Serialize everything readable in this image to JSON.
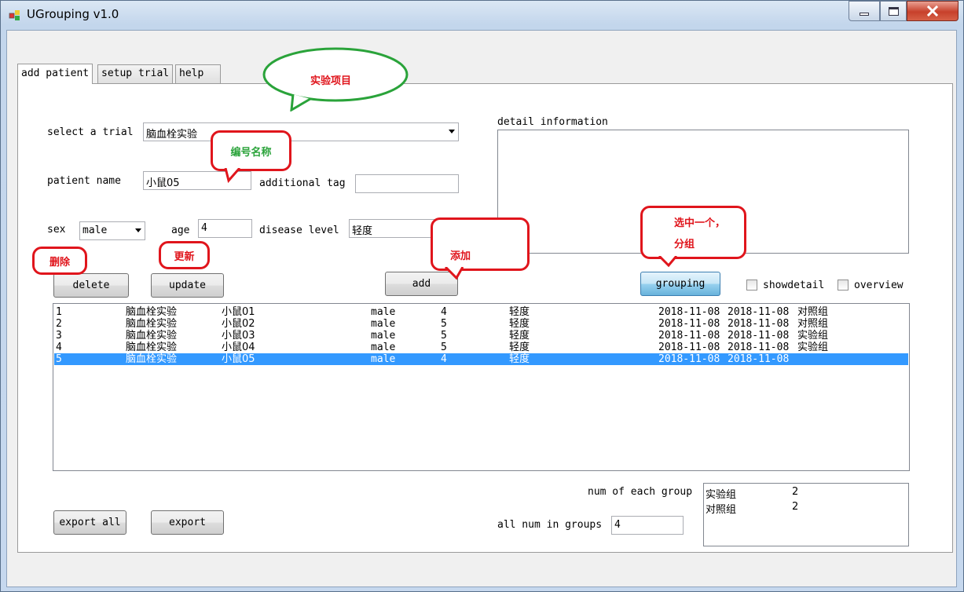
{
  "window": {
    "title": "UGrouping v1.0"
  },
  "tabs": [
    {
      "label": "add patient"
    },
    {
      "label": "setup trial"
    },
    {
      "label": "help"
    }
  ],
  "form": {
    "trial_label": "select a trial",
    "trial_value": "脑血栓实验",
    "patient_name_label": "patient name",
    "patient_name_value": "小鼠05",
    "additional_tag_label": "additional tag",
    "additional_tag_value": "",
    "sex_label": "sex",
    "sex_value": "male",
    "age_label": "age",
    "age_value": "4",
    "disease_level_label": "disease level",
    "disease_level_value": "轻度",
    "detail_label": "detail information",
    "detail_value": ""
  },
  "buttons": {
    "delete": "delete",
    "update": "update",
    "add": "add",
    "grouping": "grouping",
    "export_all": "export all",
    "export": "export"
  },
  "checkboxes": {
    "showdetail": "showdetail",
    "overview": "overview"
  },
  "patients": [
    {
      "id": "1",
      "trial": "脑血栓实验",
      "name": "小鼠01",
      "sex": "male",
      "age": "4",
      "level": "轻度",
      "date1": "2018-11-08",
      "date2": "2018-11-08",
      "group": "对照组"
    },
    {
      "id": "2",
      "trial": "脑血栓实验",
      "name": "小鼠02",
      "sex": "male",
      "age": "5",
      "level": "轻度",
      "date1": "2018-11-08",
      "date2": "2018-11-08",
      "group": "对照组"
    },
    {
      "id": "3",
      "trial": "脑血栓实验",
      "name": "小鼠03",
      "sex": "male",
      "age": "5",
      "level": "轻度",
      "date1": "2018-11-08",
      "date2": "2018-11-08",
      "group": "实验组"
    },
    {
      "id": "4",
      "trial": "脑血栓实验",
      "name": "小鼠04",
      "sex": "male",
      "age": "5",
      "level": "轻度",
      "date1": "2018-11-08",
      "date2": "2018-11-08",
      "group": "实验组"
    },
    {
      "id": "5",
      "trial": "脑血栓实验",
      "name": "小鼠05",
      "sex": "male",
      "age": "4",
      "level": "轻度",
      "date1": "2018-11-08",
      "date2": "2018-11-08",
      "group": ""
    }
  ],
  "summary": {
    "num_each_label": "num of each group",
    "groups": [
      {
        "name": "实验组",
        "count": "2"
      },
      {
        "name": "对照组",
        "count": "2"
      }
    ],
    "all_num_label": "all num in groups",
    "all_num_value": "4"
  },
  "annotations": {
    "trial_item": "实验项目",
    "code_name": "编号名称",
    "delete": "删除",
    "update": "更新",
    "add": "添加",
    "select_group_line1": "选中一个，",
    "select_group_line2": "分组"
  },
  "colors": {
    "selection": "#3399ff",
    "annotation_red": "#e0151c",
    "annotation_green": "#2aa33a"
  }
}
